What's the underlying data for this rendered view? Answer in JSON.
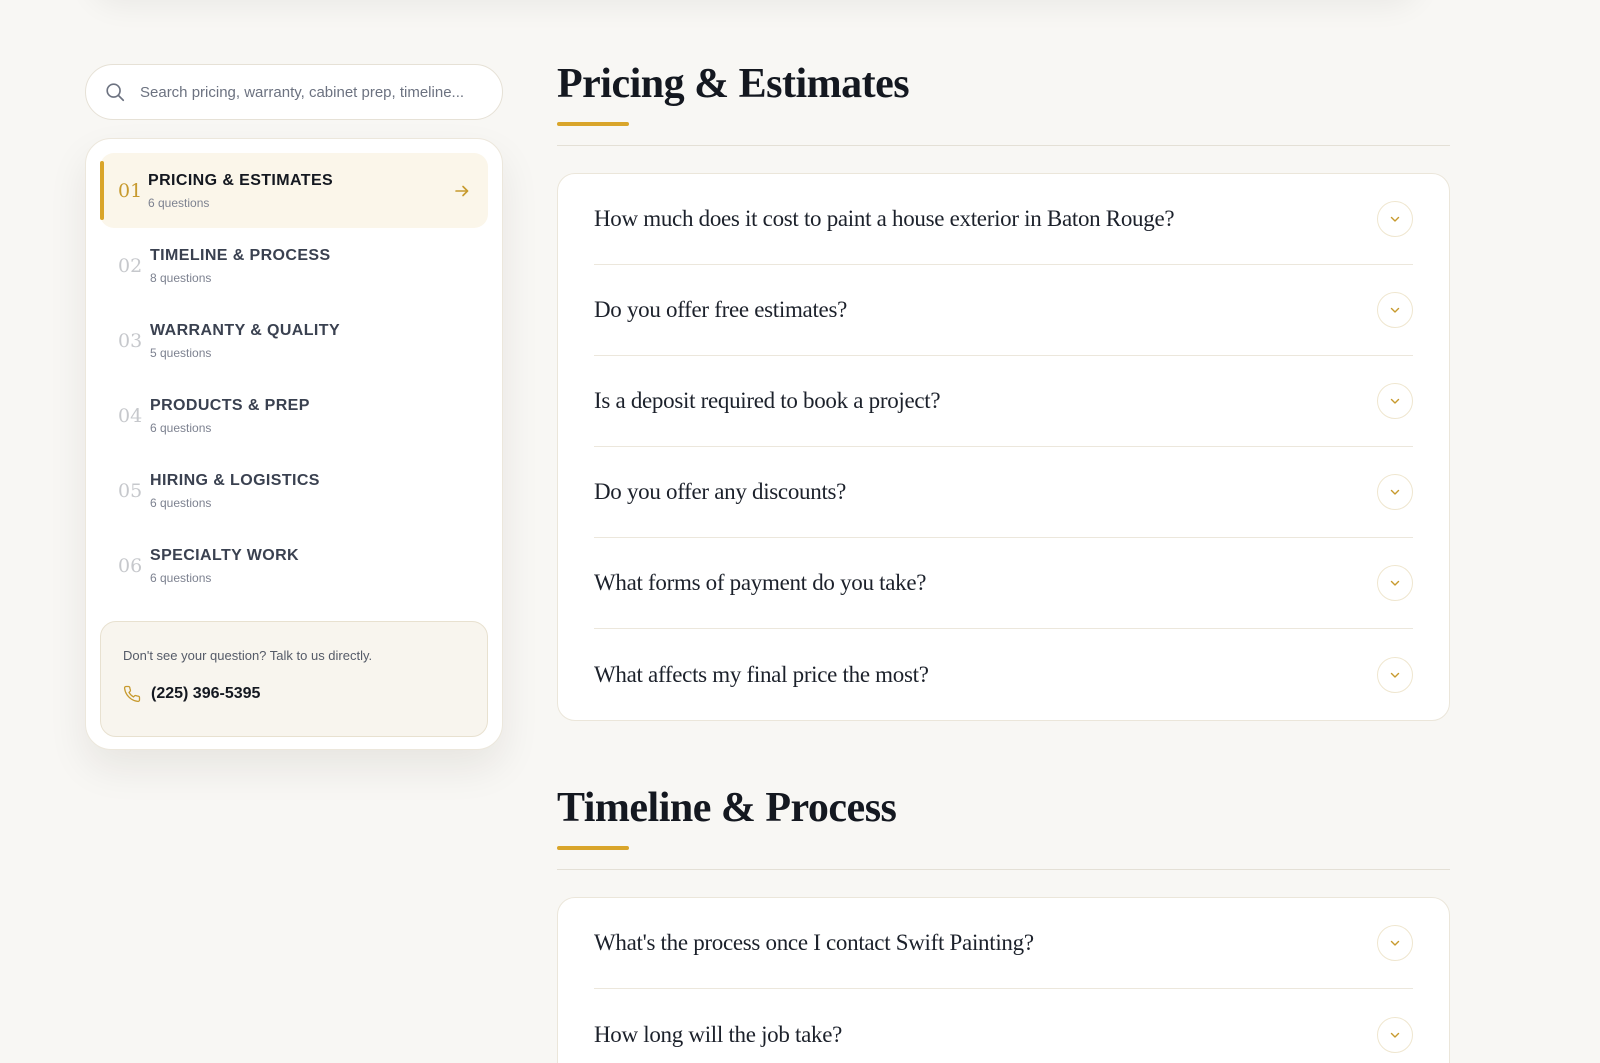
{
  "search": {
    "placeholder": "Search pricing, warranty, cabinet prep, timeline..."
  },
  "nav": {
    "items": [
      {
        "num": "01",
        "title": "PRICING & ESTIMATES",
        "sub": "6 questions"
      },
      {
        "num": "02",
        "title": "TIMELINE & PROCESS",
        "sub": "8 questions"
      },
      {
        "num": "03",
        "title": "WARRANTY & QUALITY",
        "sub": "5 questions"
      },
      {
        "num": "04",
        "title": "PRODUCTS & PREP",
        "sub": "6 questions"
      },
      {
        "num": "05",
        "title": "HIRING & LOGISTICS",
        "sub": "6 questions"
      },
      {
        "num": "06",
        "title": "SPECIALTY WORK",
        "sub": "6 questions"
      }
    ]
  },
  "contact": {
    "text": "Don't see your question? Talk to us directly.",
    "phone": "(225) 396-5395"
  },
  "sections": [
    {
      "title": "Pricing & Estimates",
      "questions": [
        "How much does it cost to paint a house exterior in Baton Rouge?",
        "Do you offer free estimates?",
        "Is a deposit required to book a project?",
        "Do you offer any discounts?",
        "What forms of payment do you take?",
        "What affects my final price the most?"
      ]
    },
    {
      "title": "Timeline & Process",
      "questions": [
        "What's the process once I contact Swift Painting?",
        "How long will the job take?"
      ]
    }
  ],
  "colors": {
    "accent": "#d9a52a",
    "background": "#f8f7f4"
  }
}
